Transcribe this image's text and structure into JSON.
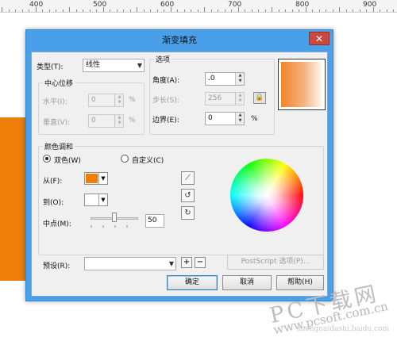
{
  "ruler": {
    "numbers": [
      "400",
      "500",
      "600",
      "700",
      "800",
      "900"
    ]
  },
  "dialog": {
    "title": "渐变填充",
    "close_label": "✕",
    "type_label": "类型(T):",
    "type_value": "线性",
    "options_title": "选项",
    "center_offset_title": "中心位移",
    "horizontal_label": "水平(I):",
    "horizontal_value": "0",
    "horizontal_unit": "%",
    "vertical_label": "垂直(V):",
    "vertical_value": "0",
    "vertical_unit": "%",
    "angle_label": "角度(A):",
    "angle_value": ".0",
    "steps_label": "步长(S):",
    "steps_value": "256",
    "edge_label": "边界(E):",
    "edge_value": "0",
    "edge_unit": "%",
    "color_blend_title": "颜色调和",
    "two_color_label": "双色(W)",
    "custom_label": "自定义(C)",
    "from_label": "从(F):",
    "from_color": "#ee7e0a",
    "to_label": "到(O):",
    "to_color": "#ffffff",
    "midpoint_label": "中点(M):",
    "midpoint_value": "50",
    "midpoint_level": 0.5,
    "preset_label": "预设(R):",
    "preset_value": "",
    "postscript_label": "PostScript 选项(P)...",
    "ok_label": "确定",
    "cancel_label": "取消",
    "help_label": "帮助(H)",
    "title_color": "#4aa0e8"
  },
  "watermark": {
    "big": "PC下载网",
    "url": "www.pcsoft.com.cn",
    "small": "shengnaidashi.baidu.com"
  }
}
